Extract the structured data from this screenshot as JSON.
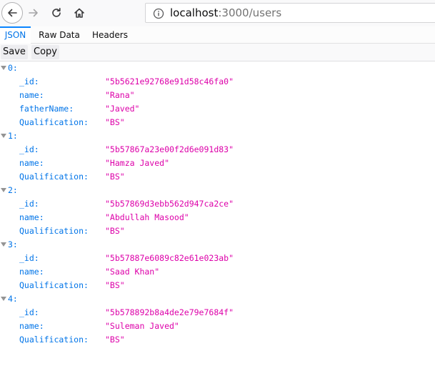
{
  "browser": {
    "url_host": "localhost",
    "url_path": ":3000/users"
  },
  "tabs": [
    {
      "label": "JSON",
      "selected": true
    },
    {
      "label": "Raw Data",
      "selected": false
    },
    {
      "label": "Headers",
      "selected": false
    }
  ],
  "actions": {
    "save_label": "Save",
    "copy_label": "Copy"
  },
  "colors": {
    "key": "#0074e8",
    "string": "#dd00a9",
    "tab_accent": "#0a84ff"
  },
  "records": [
    {
      "index_label": "0:",
      "fields": [
        {
          "key": "_id:",
          "value": "\"5b5621e92768e91d58c46fa0\""
        },
        {
          "key": "name:",
          "value": "\"Rana\""
        },
        {
          "key": "fatherName:",
          "value": "\"Javed\""
        },
        {
          "key": "Qualification:",
          "value": "\"BS\""
        }
      ]
    },
    {
      "index_label": "1:",
      "fields": [
        {
          "key": "_id:",
          "value": "\"5b57867a23e00f2d6e091d83\""
        },
        {
          "key": "name:",
          "value": "\"Hamza Javed\""
        },
        {
          "key": "Qualification:",
          "value": "\"BS\""
        }
      ]
    },
    {
      "index_label": "2:",
      "fields": [
        {
          "key": "_id:",
          "value": "\"5b57869d3ebb562d947ca2ce\""
        },
        {
          "key": "name:",
          "value": "\"Abdullah Masood\""
        },
        {
          "key": "Qualification:",
          "value": "\"BS\""
        }
      ]
    },
    {
      "index_label": "3:",
      "fields": [
        {
          "key": "_id:",
          "value": "\"5b57887e6089c82e61e023ab\""
        },
        {
          "key": "name:",
          "value": "\"Saad Khan\""
        },
        {
          "key": "Qualification:",
          "value": "\"BS\""
        }
      ]
    },
    {
      "index_label": "4:",
      "fields": [
        {
          "key": "_id:",
          "value": "\"5b578892b8a4de2e79e7684f\""
        },
        {
          "key": "name:",
          "value": "\"Suleman Javed\""
        },
        {
          "key": "Qualification:",
          "value": "\"BS\""
        }
      ]
    }
  ]
}
